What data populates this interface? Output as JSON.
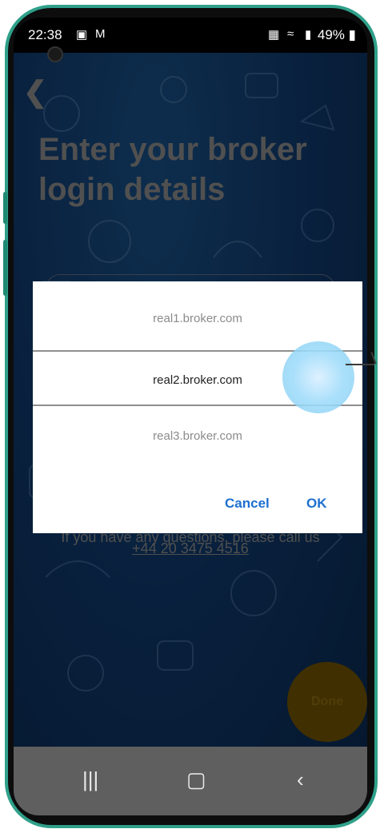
{
  "status_bar": {
    "time": "22:38",
    "left_icons": [
      "image-icon",
      "gmail-icon"
    ],
    "battery": "49%",
    "right_icons": [
      "nfc-icon",
      "wifi-icon",
      "signal-icon",
      "battery-icon"
    ]
  },
  "page": {
    "title_line1": "Enter your broker",
    "title_line2": "login details",
    "help_text": "If you have any questions, please call us",
    "help_phone": "+44 20 3475 4516",
    "done_label": "Done"
  },
  "dialog": {
    "options": [
      "real1.broker.com",
      "real2.broker.com",
      "real3.broker.com"
    ],
    "selected_index": 1,
    "cancel_label": "Cancel",
    "ok_label": "OK"
  },
  "colors": {
    "accent": "#1d6fd0",
    "done_button": "#6e5200",
    "phone_frame": "#2fa08a"
  }
}
